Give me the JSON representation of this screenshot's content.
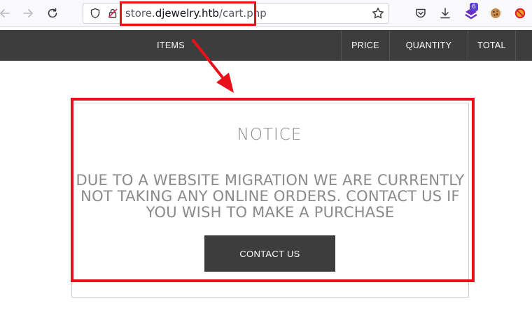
{
  "browser": {
    "url_prefix": "store.",
    "url_host": "djewelry.htb",
    "url_path": "/cart.php",
    "extension_badge": "6"
  },
  "nav": {
    "items_label": "ITEMS",
    "price_label": "PRICE",
    "quantity_label": "QUANTITY",
    "total_label": "TOTAL"
  },
  "notice": {
    "title": "NOTICE",
    "message": "Due to a website migration we are currently not taking any online orders. Contact us if you wish to make a purchase",
    "button_label": "CONTACT US"
  },
  "icons": {
    "back": "arrow-left-icon",
    "forward": "arrow-right-icon",
    "reload": "reload-icon",
    "shield": "shield-icon",
    "insecure-lock": "insecure-lock-icon",
    "bookmark": "star-icon",
    "pocket": "pocket-icon",
    "downloads": "download-icon",
    "extension": "extension-icon",
    "cookie": "cookie-icon",
    "blocker": "blocker-icon"
  },
  "colors": {
    "annotation_red": "#e8101a",
    "nav_bg": "#3d3d3d",
    "notice_text": "#8a8a8a"
  }
}
